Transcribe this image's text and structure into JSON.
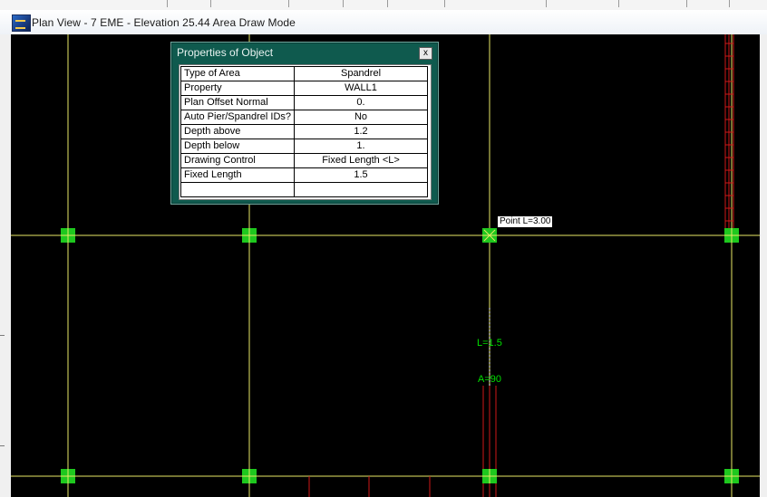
{
  "window": {
    "title": "Plan View - 7 EME - Elevation 25.44   Area Draw Mode",
    "app_icon": "etabs-app-icon"
  },
  "properties_dialog": {
    "title": "Properties of Object",
    "close_label": "x",
    "rows": [
      {
        "key": "Type of Area",
        "value": "Spandrel"
      },
      {
        "key": "Property",
        "value": "WALL1"
      },
      {
        "key": "Plan Offset Normal",
        "value": "0."
      },
      {
        "key": "Auto Pier/Spandrel IDs?",
        "value": "No"
      },
      {
        "key": "Depth above",
        "value": "1.2"
      },
      {
        "key": "Depth below",
        "value": "1."
      },
      {
        "key": "Drawing Control",
        "value": "Fixed Length  <L>"
      },
      {
        "key": "Fixed Length",
        "value": "1.5"
      },
      {
        "key": "",
        "value": ""
      }
    ]
  },
  "canvas": {
    "snap_tooltip": "Point  L=3.00",
    "length_label": "L=1.5",
    "angle_label": "A=90",
    "colors": {
      "background": "#000000",
      "grid_line": "#e8e866",
      "joint": "#1ec81e",
      "frame": "#d01818",
      "label": "#00e000"
    }
  }
}
